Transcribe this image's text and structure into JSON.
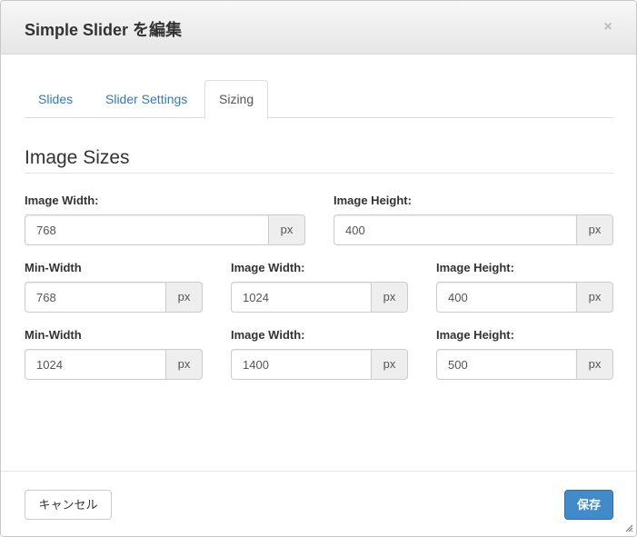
{
  "modal": {
    "title": "Simple Slider を編集",
    "close_glyph": "×"
  },
  "tabs": [
    {
      "label": "Slides",
      "active": false
    },
    {
      "label": "Slider Settings",
      "active": false
    },
    {
      "label": "Sizing",
      "active": true
    }
  ],
  "section": {
    "title": "Image Sizes"
  },
  "unit": "px",
  "default_size": {
    "width_label": "Image Width:",
    "width_value": "768",
    "height_label": "Image Height:",
    "height_value": "400"
  },
  "breakpoints": [
    {
      "min_width_label": "Min-Width",
      "min_width_value": "768",
      "width_label": "Image Width:",
      "width_value": "1024",
      "height_label": "Image Height:",
      "height_value": "400"
    },
    {
      "min_width_label": "Min-Width",
      "min_width_value": "1024",
      "width_label": "Image Width:",
      "width_value": "1400",
      "height_label": "Image Height:",
      "height_value": "500"
    }
  ],
  "footer": {
    "cancel_label": "キャンセル",
    "save_label": "保存"
  },
  "colors": {
    "link": "#337ab7",
    "primary": "#428bca"
  }
}
